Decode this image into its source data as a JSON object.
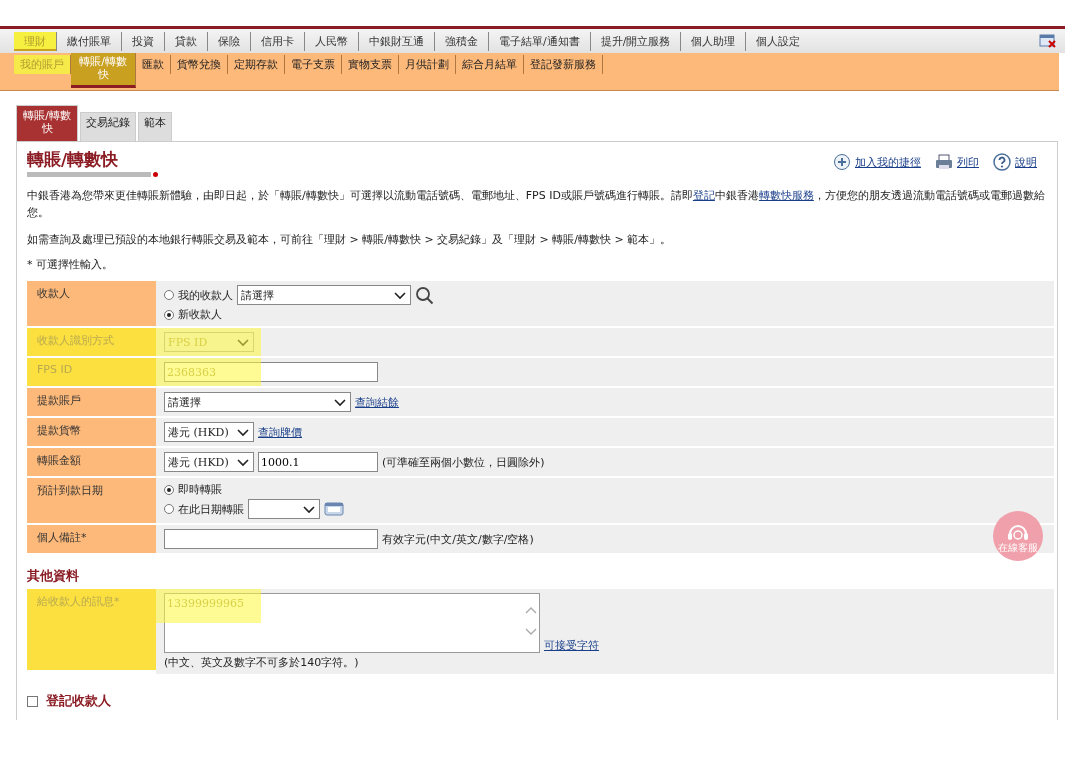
{
  "top_menu": [
    {
      "label": "理財",
      "selected": true,
      "highlighted": true
    },
    {
      "label": "繳付賬單",
      "selected": false,
      "highlighted": false
    },
    {
      "label": "投資",
      "selected": false,
      "highlighted": false
    },
    {
      "label": "貸款",
      "selected": false,
      "highlighted": false
    },
    {
      "label": "保險",
      "selected": false,
      "highlighted": false
    },
    {
      "label": "信用卡",
      "selected": false,
      "highlighted": false
    },
    {
      "label": "人民幣",
      "selected": false,
      "highlighted": false
    },
    {
      "label": "中銀財互通",
      "selected": false,
      "highlighted": false
    },
    {
      "label": "強積金",
      "selected": false,
      "highlighted": false
    },
    {
      "label": "電子結單/通知書",
      "selected": false,
      "highlighted": false
    },
    {
      "label": "提升/開立服務",
      "selected": false,
      "highlighted": false
    },
    {
      "label": "個人助理",
      "selected": false,
      "highlighted": false
    },
    {
      "label": "個人設定",
      "selected": false,
      "highlighted": false
    }
  ],
  "sub_menu": [
    {
      "label": "我的賬戶",
      "selected": false,
      "highlighted": true
    },
    {
      "label": "轉賬/轉數快",
      "selected": true,
      "highlighted": false
    },
    {
      "label": "匯款",
      "selected": false,
      "highlighted": false
    },
    {
      "label": "貨幣兌換",
      "selected": false,
      "highlighted": false
    },
    {
      "label": "定期存款",
      "selected": false,
      "highlighted": false
    },
    {
      "label": "電子支票",
      "selected": false,
      "highlighted": false
    },
    {
      "label": "實物支票",
      "selected": false,
      "highlighted": false
    },
    {
      "label": "月供計劃",
      "selected": false,
      "highlighted": false
    },
    {
      "label": "綜合月結單",
      "selected": false,
      "highlighted": false
    },
    {
      "label": "登記發薪服務",
      "selected": false,
      "highlighted": false
    }
  ],
  "tabs": [
    {
      "label": "轉賬/轉數快",
      "selected": true
    },
    {
      "label": "交易紀錄",
      "selected": false
    },
    {
      "label": "範本",
      "selected": false
    }
  ],
  "page_title": "轉賬/轉數快",
  "page_links": [
    {
      "kind": "add",
      "label": "加入我的捷徑"
    },
    {
      "kind": "print",
      "label": "列印"
    },
    {
      "kind": "help",
      "label": "說明"
    }
  ],
  "intro": [
    [
      {
        "kind": "text",
        "text": "中銀香港為您帶來更佳轉賬新體驗，由即日起，於「轉賬/轉數快」可選擇以流動電話號碼、電郵地址、FPS ID或賬戶號碼進行轉賬。請即"
      },
      {
        "kind": "link",
        "text": "登記"
      },
      {
        "kind": "text",
        "text": "中銀香港"
      },
      {
        "kind": "link",
        "text": "轉數快服務"
      },
      {
        "kind": "text",
        "text": "，方便您的朋友透過流動電話號碼或電郵過數給您。"
      }
    ],
    [
      {
        "kind": "text",
        "text": "如需查詢及處理已預設的本地銀行轉賬交易及範本，可前往「理財 > 轉賬/轉數快 > 交易紀錄」及「理財 > 轉賬/轉數快 > 範本」。"
      }
    ],
    [
      {
        "kind": "text",
        "text": "* 可選擇性輸入。"
      }
    ]
  ],
  "form": [
    {
      "label": "收款人",
      "highlighted": false,
      "lines": [
        [
          {
            "kind": "radio",
            "label": "我的收款人",
            "selected": false
          },
          {
            "kind": "wideselect",
            "value": "請選擇"
          },
          {
            "kind": "search"
          }
        ],
        [
          {
            "kind": "radio",
            "label": "新收款人",
            "selected": true
          }
        ]
      ]
    },
    {
      "label": "收款人識別方式",
      "highlighted": true,
      "lines": [
        [
          {
            "kind": "select",
            "value": "FPS ID"
          }
        ]
      ]
    },
    {
      "label": "FPS ID",
      "highlighted": true,
      "lines": [
        [
          {
            "kind": "input",
            "value": "2368363"
          }
        ]
      ]
    },
    {
      "label": "提款賬戶",
      "highlighted": false,
      "lines": [
        [
          {
            "kind": "wideselect",
            "value": "請選擇"
          },
          {
            "kind": "link",
            "label": "查詢結餘"
          }
        ]
      ]
    },
    {
      "label": "提款貨幣",
      "highlighted": false,
      "lines": [
        [
          {
            "kind": "select",
            "value": "港元 (HKD)"
          },
          {
            "kind": "link",
            "label": "查詢牌價"
          }
        ]
      ]
    },
    {
      "label": "轉賬金額",
      "highlighted": false,
      "lines": [
        [
          {
            "kind": "select",
            "value": "港元 (HKD)"
          },
          {
            "kind": "input",
            "value": "1000.1"
          },
          {
            "kind": "note",
            "label": "(可準確至兩個小數位，日圓除外)"
          }
        ]
      ]
    },
    {
      "label": "預計到款日期",
      "highlighted": false,
      "lines": [
        [
          {
            "kind": "radio",
            "label": "即時轉賬",
            "selected": true
          }
        ],
        [
          {
            "kind": "radio",
            "label": "在此日期轉賬",
            "selected": false
          },
          {
            "kind": "dateselect"
          },
          {
            "kind": "calendar"
          }
        ]
      ]
    },
    {
      "label": "個人備註*",
      "highlighted": false,
      "lines": [
        [
          {
            "kind": "input"
          },
          {
            "kind": "note",
            "label": "有效字元(中文/英文/數字/空格)"
          }
        ]
      ]
    }
  ],
  "other_heading": "其他資料",
  "other_form": [
    {
      "label": "給收款人的訊息*",
      "highlighted": true,
      "lines": [
        [
          {
            "kind": "textarea",
            "value": "13399999965"
          },
          {
            "kind": "link",
            "label": "可接受字符"
          }
        ],
        [
          {
            "kind": "note",
            "label": "(中文、英文及數字不可多於140字符。)"
          }
        ]
      ]
    }
  ],
  "register": {
    "label": "登記收款人",
    "checked": false
  },
  "chat_button": "在線客服"
}
